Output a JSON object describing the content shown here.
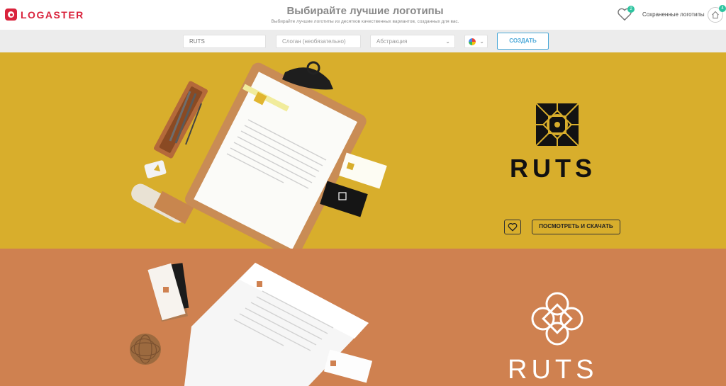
{
  "header": {
    "logo_text": "LOGASTER",
    "title": "Выбирайте лучшие логотипы",
    "subtitle": "Выбирайте лучшие логотипы из десятков качественных вариантов, созданных для вас.",
    "favorites_count": "2",
    "saved_label": "Сохраненные логотипы",
    "saved_count": "4"
  },
  "search": {
    "name_value": "RUTS",
    "slogan_placeholder": "Слоган (необязательно)",
    "style_value": "Абстракция",
    "create_label": "СОЗДАТЬ"
  },
  "panels": [
    {
      "brand": "RUTS",
      "background": "#d8ae2c",
      "view_label": "ПОСМОТРЕТЬ И СКАЧАТЬ"
    },
    {
      "brand": "RUTS",
      "background": "#cf8150"
    }
  ],
  "colors": {
    "accent": "#d9233c",
    "button": "#4aa8d8",
    "badge": "#2ec4a0"
  },
  "icons": [
    "heart-icon",
    "home-icon",
    "chevron-down-icon",
    "color-palette-icon"
  ]
}
